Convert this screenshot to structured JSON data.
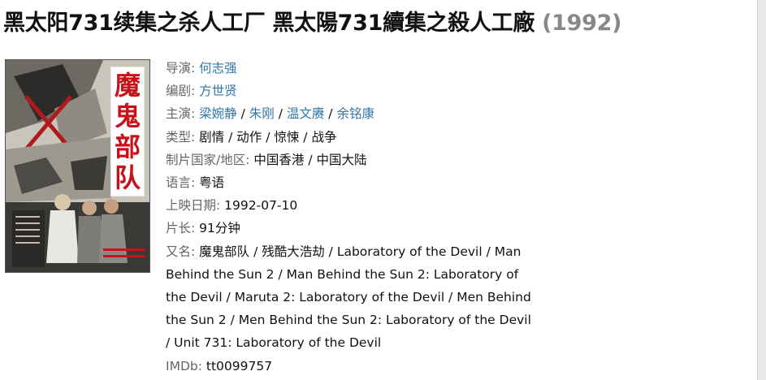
{
  "title": {
    "main": "黑太阳731续集之杀人工厂 黑太陽731續集之殺人工廠",
    "year": "(1992)"
  },
  "poster": {
    "caption": [
      "魔",
      "鬼",
      "部",
      "队"
    ]
  },
  "info": {
    "director": {
      "label": "导演:",
      "names": [
        "何志强"
      ]
    },
    "writer": {
      "label": "编剧:",
      "names": [
        "方世贤"
      ]
    },
    "cast": {
      "label": "主演:",
      "names": [
        "梁婉静",
        "朱刚",
        "温文赓",
        "余铭康"
      ]
    },
    "genre": {
      "label": "类型:",
      "values": [
        "剧情",
        "动作",
        "惊悚",
        "战争"
      ]
    },
    "country": {
      "label": "制片国家/地区:",
      "value": "中国香港 / 中国大陆"
    },
    "language": {
      "label": "语言:",
      "value": "粤语"
    },
    "release": {
      "label": "上映日期:",
      "value": "1992-07-10"
    },
    "runtime": {
      "label": "片长:",
      "value": "91分钟"
    },
    "aka": {
      "label": "又名:",
      "value": "魔鬼部队 / 残酷大浩劫 / Laboratory of the Devil / Man Behind the Sun 2 / Man Behind the Sun 2: Laboratory of the Devil / Maruta 2: Laboratory of the Devil / Men Behind the Sun 2 / Men Behind the Sun 2: Laboratory of the Devil / Unit 731: Laboratory of the Devil"
    },
    "imdb": {
      "label": "IMDb:",
      "value": "tt0099757"
    }
  },
  "colors": {
    "link": "#3377aa",
    "label": "#666666",
    "year": "#888888",
    "poster_title": "#c7121a"
  }
}
